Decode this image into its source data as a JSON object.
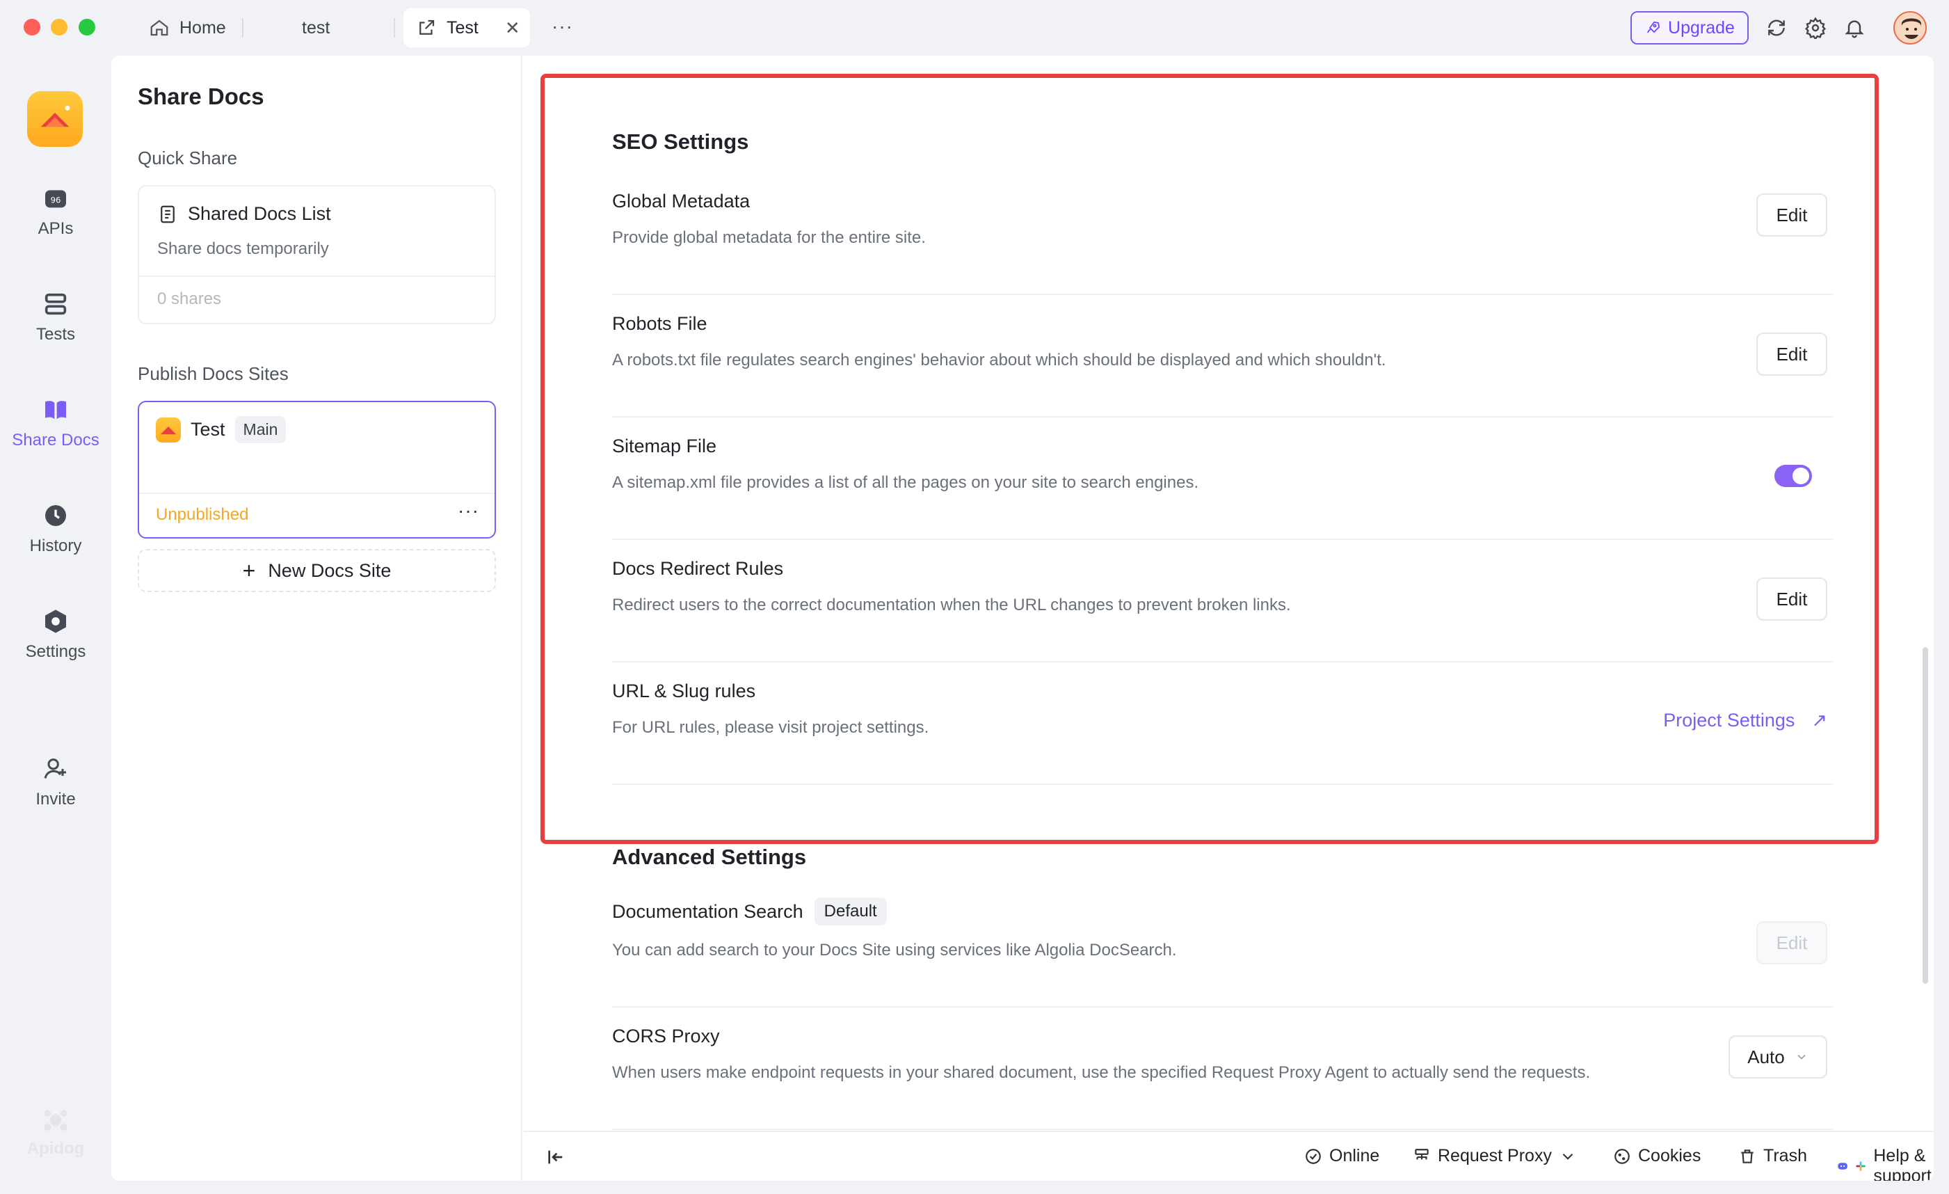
{
  "tabs": {
    "home": "Home",
    "second": "test",
    "active": "Test"
  },
  "titlebar": {
    "upgrade": "Upgrade"
  },
  "nav": {
    "apis": "APIs",
    "tests": "Tests",
    "share_docs": "Share Docs",
    "history": "History",
    "settings": "Settings",
    "invite": "Invite",
    "brand": "Apidog"
  },
  "sidebar": {
    "title": "Share Docs",
    "quick_share_label": "Quick Share",
    "shared_list_title": "Shared Docs List",
    "shared_list_sub": "Share docs temporarily",
    "shares_count": "0 shares",
    "publish_label": "Publish Docs Sites",
    "site_name": "Test",
    "site_branch": "Main",
    "site_status": "Unpublished",
    "new_site": "New Docs Site"
  },
  "seo": {
    "heading": "SEO Settings",
    "rows": [
      {
        "title": "Global Metadata",
        "desc": "Provide global metadata for the entire site.",
        "action": "Edit"
      },
      {
        "title": "Robots File",
        "desc": "A robots.txt file regulates search engines' behavior about which should be displayed and which shouldn't.",
        "action": "Edit"
      },
      {
        "title": "Sitemap File",
        "desc": "A sitemap.xml file provides a list of all the pages on your site to search engines.",
        "toggle_on": true
      },
      {
        "title": "Docs Redirect Rules",
        "desc": "Redirect users to the correct documentation when the URL changes to prevent broken links.",
        "action": "Edit"
      },
      {
        "title": "URL & Slug rules",
        "desc": "For URL rules, please visit project settings.",
        "link": "Project Settings"
      }
    ]
  },
  "advanced": {
    "heading": "Advanced Settings",
    "rows": [
      {
        "title": "Documentation Search",
        "badge": "Default",
        "desc": "You can add search to your Docs Site using services like Algolia DocSearch.",
        "action": "Edit"
      },
      {
        "title": "CORS Proxy",
        "desc": "When users make endpoint requests in your shared document, use the specified Request Proxy Agent to actually send the requests.",
        "select": "Auto"
      }
    ]
  },
  "bottombar": {
    "online": "Online",
    "request_proxy": "Request Proxy",
    "cookies": "Cookies",
    "trash": "Trash",
    "help": "Help & support"
  },
  "colors": {
    "accent": "#7b5cf5",
    "highlight": "#e8403f",
    "warning": "#f5a623"
  }
}
